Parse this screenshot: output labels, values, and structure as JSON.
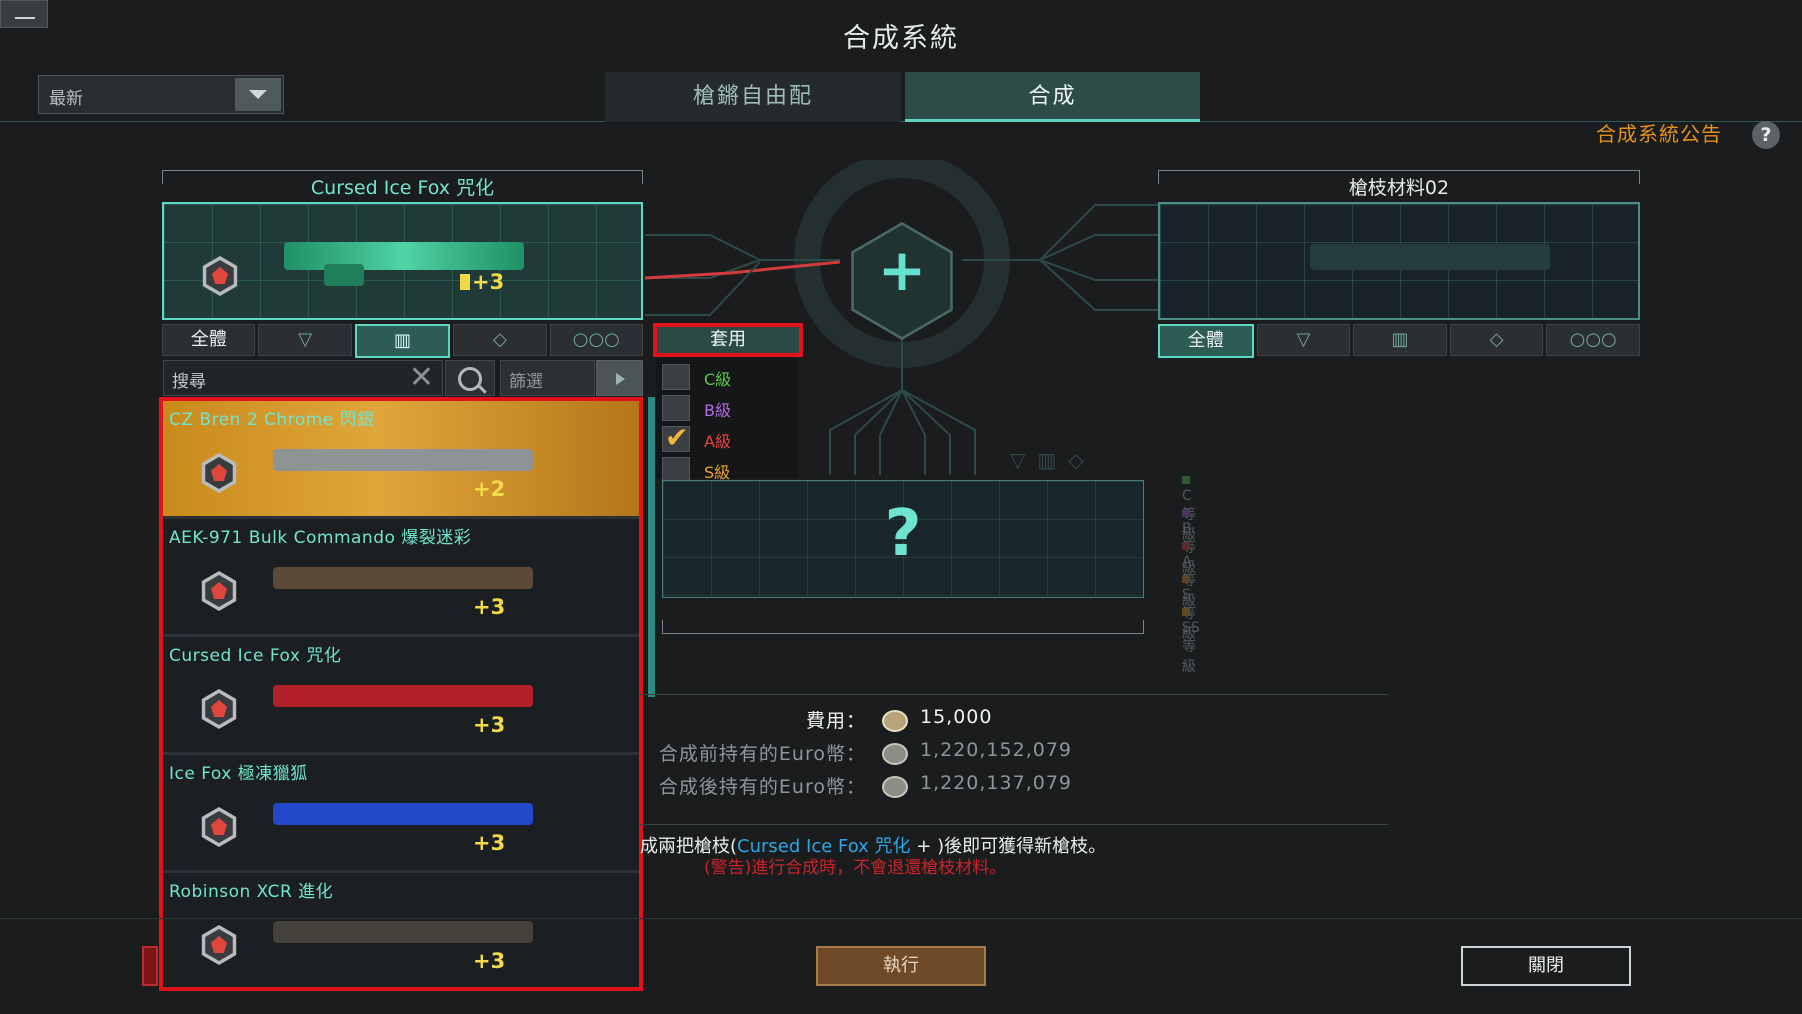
{
  "window": {
    "title": "合成系統",
    "minimize_label": ""
  },
  "sort": {
    "selected": "最新"
  },
  "tabs": [
    {
      "label": "槍鏘自由配"
    },
    {
      "label": "合成"
    }
  ],
  "notice": {
    "label": "合成系統公告",
    "help": "?"
  },
  "left_slot": {
    "name": "Cursed Ice Fox 咒化",
    "ammo": "+3"
  },
  "right_slot": {
    "name": "槍枝材料02"
  },
  "filter_tabs": {
    "all": "全體"
  },
  "search": {
    "placeholder": "搜尋",
    "filter_placeholder": "篩選"
  },
  "apply": {
    "label": "套用"
  },
  "grades": [
    {
      "label": "C級",
      "color": "#5ec94a",
      "checked": false
    },
    {
      "label": "B級",
      "color": "#b26de0",
      "checked": false
    },
    {
      "label": "A級",
      "color": "#e8433c",
      "checked": true
    },
    {
      "label": "S級",
      "color": "#f0a12b",
      "checked": false
    }
  ],
  "weapons": [
    {
      "name": "CZ Bren 2 Chrome 閃銀",
      "ammo": "+2",
      "gun_color": "#8f9396",
      "selected": true
    },
    {
      "name": "AEK-971 Bulk Commando 爆裂迷彩",
      "ammo": "+3",
      "gun_color": "#5b4a36",
      "selected": false
    },
    {
      "name": "Cursed Ice Fox 咒化",
      "ammo": "+3",
      "gun_color": "#b3202a",
      "selected": false
    },
    {
      "name": "Ice Fox 極凍獵狐",
      "ammo": "+3",
      "gun_color": "#2247c8",
      "selected": false
    },
    {
      "name": "Robinson XCR 進化",
      "ammo": "+3",
      "gun_color": "#45413b",
      "selected": false
    }
  ],
  "result": {
    "placeholder": "?"
  },
  "legend": [
    {
      "label": "C等級",
      "color": "#2f5a35"
    },
    {
      "label": "B等級",
      "color": "#4a3560"
    },
    {
      "label": "A等級",
      "color": "#5a2b2b"
    },
    {
      "label": "S等級",
      "color": "#5a4324"
    },
    {
      "label": "SS等級",
      "color": "#5a4c24"
    }
  ],
  "cost": {
    "fee_label": "費用：",
    "fee_value": "15,000",
    "before_label": "合成前持有的Euro幣：",
    "before_value": "1,220,152,079",
    "after_label": "合成後持有的Euro幣：",
    "after_value": "1,220,137,079"
  },
  "message": {
    "prefix": "成兩把槍枝(",
    "highlight": "Cursed Ice Fox 咒化",
    "suffix": " + )後即可獲得新槍枝。"
  },
  "warning": "(警告)進行合成時，不會退還槍枝材料。",
  "buttons": {
    "execute": "執行",
    "close": "關閉"
  },
  "colors": {
    "accent": "#5fd6c3",
    "highlight_border": "#e0121a",
    "notice": "#e3921b"
  }
}
